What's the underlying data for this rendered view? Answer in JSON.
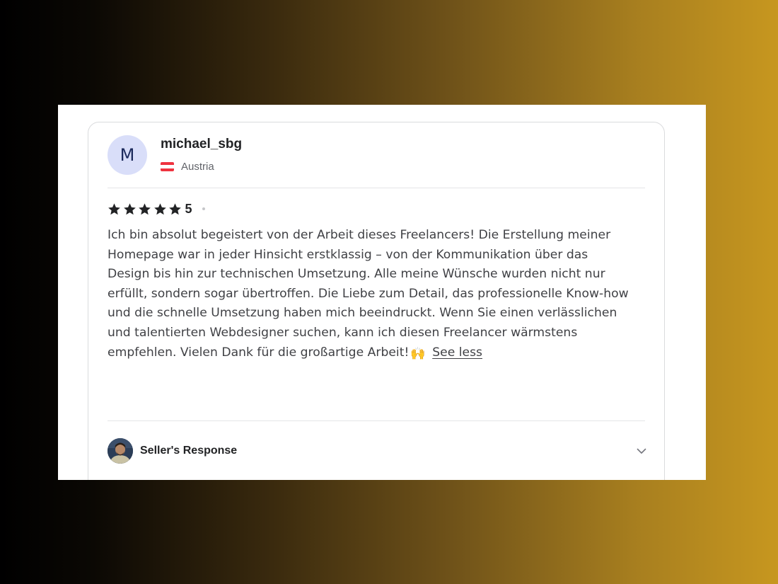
{
  "review": {
    "avatar_initial": "M",
    "username": "michael_sbg",
    "country": "Austria",
    "flag_colors": [
      "#ef3340",
      "#ffffff",
      "#ef3340"
    ],
    "star_color": "#222325",
    "rating": 5,
    "rating_label": "5",
    "text_lines": [
      "Ich bin absolut begeistert von der Arbeit dieses Freelancers! Die Erstellung meiner",
      "Homepage war in jeder Hinsicht erstklassig – von der Kommunikation über das",
      "Design bis hin zur technischen Umsetzung. Alle meine Wünsche wurden nicht nur",
      "erfüllt, sondern sogar übertroffen. Die Liebe zum Detail, das professionelle Know-how",
      "und die schnelle Umsetzung haben mich beeindruckt. Wenn Sie einen verlässlichen",
      "und talentierten Webdesigner suchen, kann ich diesen Freelancer wärmstens",
      "empfehlen. Vielen Dank für die großartige Arbeit!"
    ],
    "emoji": "🙌",
    "see_less_label": "See less"
  },
  "seller_response": {
    "label": "Seller's Response",
    "avatar_icon": "seller-avatar",
    "toggle_icon": "chevron-down-icon"
  }
}
